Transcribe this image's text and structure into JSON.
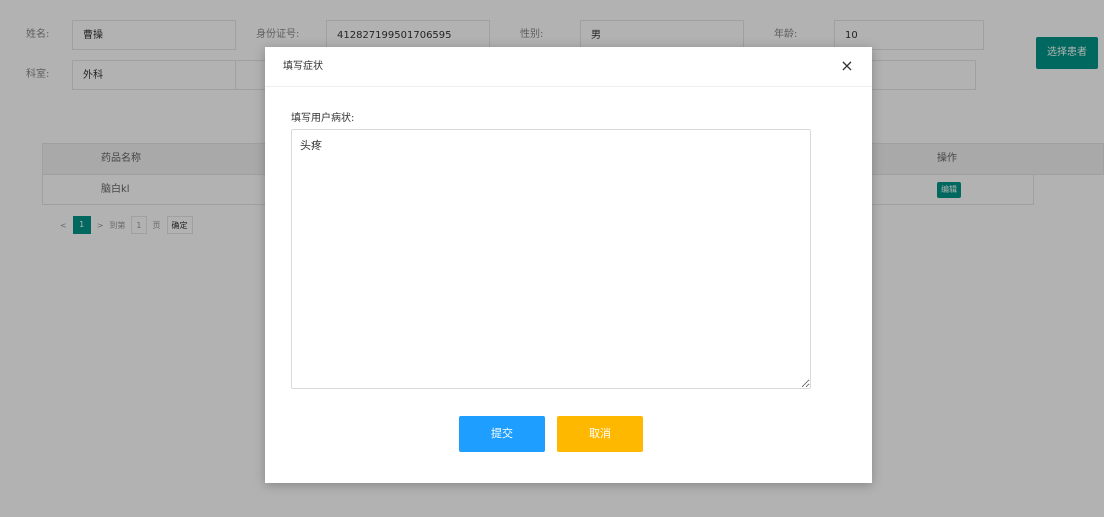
{
  "patient": {
    "name_label": "姓名:",
    "name_value": "曹操",
    "id_label": "身份证号:",
    "id_value": "412827199501706595",
    "gender_label": "性别:",
    "gender_value": "男",
    "age_label": "年龄:",
    "age_value": "10",
    "dept_label": "科室:",
    "dept_value": "外科"
  },
  "toolbar": {
    "select_patient_label": "选择患者"
  },
  "table": {
    "columns": [
      "药品名称",
      "操作"
    ],
    "rows": [
      {
        "drug_name": "脑白kl",
        "op_label": "编辑"
      }
    ]
  },
  "pager": {
    "current_page": "1",
    "goto_label": "到第",
    "page_input": "1",
    "page_unit": "页",
    "confirm_label": "确定"
  },
  "modal": {
    "title": "填写症状",
    "close_glyph": "×",
    "field_label": "填写用户病状:",
    "symptom_value": "头疼",
    "submit_label": "提交",
    "cancel_label": "取消"
  },
  "colors": {
    "primary": "#009688",
    "submit": "#1e9fff",
    "cancel": "#ffb800"
  }
}
